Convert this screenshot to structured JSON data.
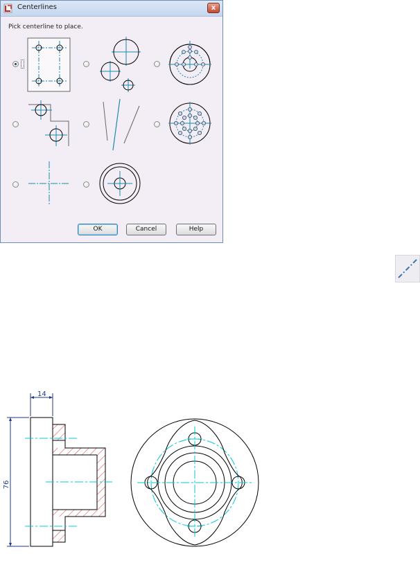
{
  "dialog": {
    "title": "Centerlines",
    "prompt": "Pick centerline to place.",
    "buttons": {
      "ok": "OK",
      "cancel": "Cancel",
      "help": "Help"
    },
    "close_glyph": "x",
    "selected_option": 1,
    "options": [
      {
        "id": 1,
        "icon": "rectangular-bolt-pattern-icon"
      },
      {
        "id": 2,
        "icon": "multiple-circles-centerline-icon"
      },
      {
        "id": 3,
        "icon": "polar-arrangement-icon"
      },
      {
        "id": 4,
        "icon": "offset-circles-icon"
      },
      {
        "id": 5,
        "icon": "bisector-lines-icon"
      },
      {
        "id": 6,
        "icon": "concentric-polar-pattern-icon"
      },
      {
        "id": 7,
        "icon": "simple-cross-centerline-icon"
      },
      {
        "id": 8,
        "icon": "concentric-circles-icon"
      }
    ]
  },
  "tool_icon": "centerline-tool-icon",
  "drawing": {
    "dim_width": "14",
    "dim_height": "76"
  },
  "colors": {
    "centerline": "#1a8ab0",
    "drawing_centerline": "#00c8d8",
    "dimension": "#1d3a8a",
    "hatch": "#e0383b",
    "outline": "#000000"
  }
}
